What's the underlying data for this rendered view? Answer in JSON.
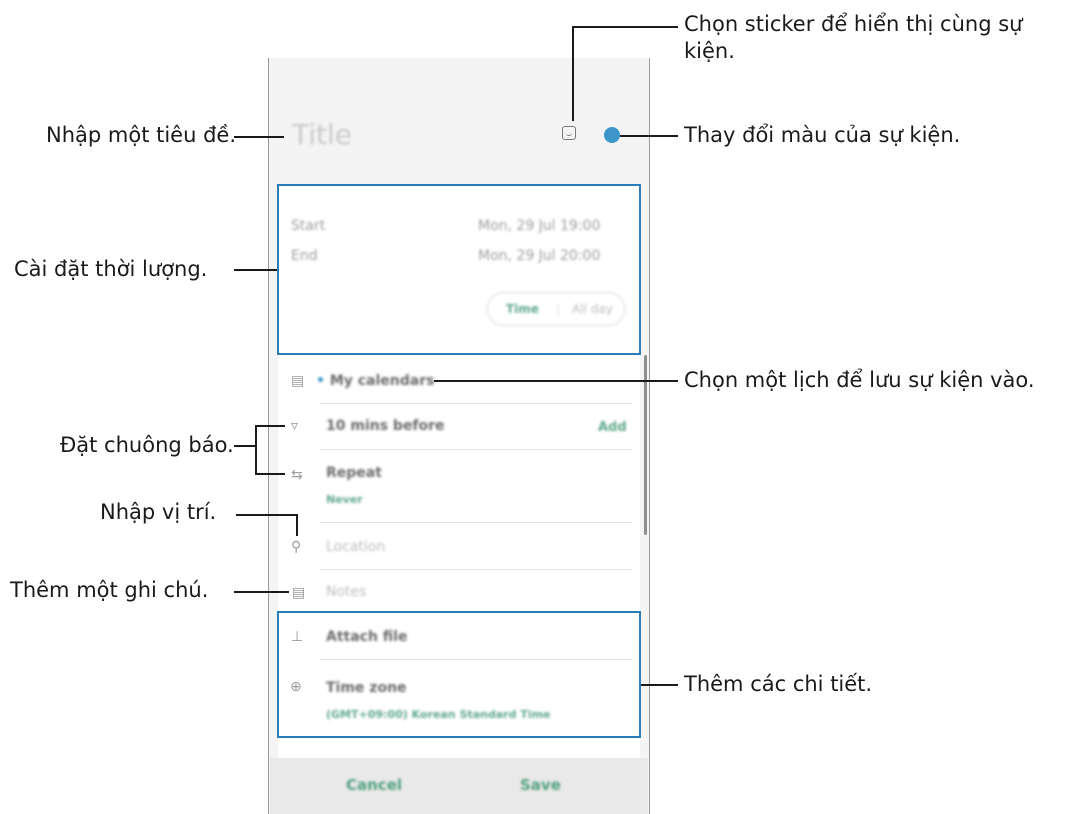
{
  "screen": {
    "title_placeholder": "Title",
    "start": {
      "label": "Start",
      "value": "Mon, 29 Jul  19:00"
    },
    "end": {
      "label": "End",
      "value": "Mon, 29 Jul  20:00"
    },
    "time_toggle": {
      "time": "Time",
      "all_day": "All day"
    },
    "calendar": "My calendars",
    "alarm": {
      "label": "10 mins before",
      "add": "Add"
    },
    "repeat": {
      "label": "Repeat",
      "value": "Never"
    },
    "location_placeholder": "Location",
    "notes_placeholder": "Notes",
    "attach_file": "Attach file",
    "time_zone": {
      "label": "Time zone",
      "value": "(GMT+09:00) Korean Standard Time"
    },
    "cancel": "Cancel",
    "save": "Save"
  },
  "colors": {
    "accent": "#3d95c9",
    "callout_box": "#2a7db8",
    "green_text": "#4f9f7f"
  },
  "annotations": {
    "sticker_line1": "Chọn sticker để hiển thị cùng sự",
    "sticker_line2": "kiện.",
    "title": "Nhập một tiêu đề.",
    "color": "Thay đổi màu của sự kiện.",
    "duration": "Cài đặt thời lượng.",
    "calendar": "Chọn một lịch để lưu sự kiện vào.",
    "alarm": "Đặt chuông báo.",
    "location": "Nhập vị trí.",
    "note": "Thêm một ghi chú.",
    "details": "Thêm các chi tiết."
  },
  "icons": [
    "sticker-icon",
    "calendar-icon",
    "bell-icon",
    "repeat-icon",
    "location-pin-icon",
    "notes-icon",
    "paperclip-icon",
    "globe-icon"
  ]
}
